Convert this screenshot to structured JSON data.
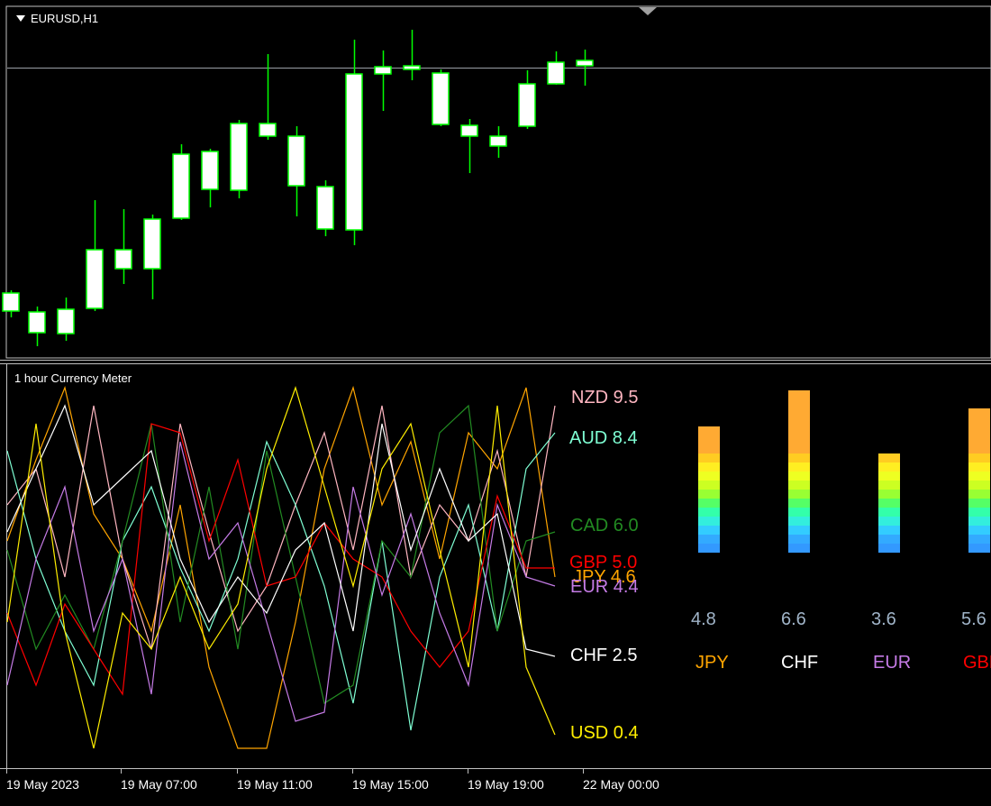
{
  "chart_window": {
    "symbol_title": "EURUSD,H1",
    "indicator_title": "1 hour Currency Meter",
    "time_labels": [
      "19 May 2023",
      "19 May 07:00",
      "19 May 11:00",
      "19 May 15:00",
      "19 May 19:00",
      "22 May 00:00"
    ]
  },
  "colors": {
    "background": "#000000",
    "bull_candle_border": "#00ff00",
    "candle_body": "#ffffff",
    "wick": "#00ff00",
    "price_line": "#9aa0a6",
    "separator": "#c0c0c0"
  },
  "currencies": {
    "NZD": {
      "label": "NZD 9.5",
      "color": "#ffb6c1"
    },
    "AUD": {
      "label": "AUD 8.4",
      "color": "#7fffd4"
    },
    "CAD": {
      "label": "CAD 6.0",
      "color": "#228b22"
    },
    "GBP": {
      "label": "GBP 5.0",
      "color": "#ff0000"
    },
    "JPY": {
      "label": "JPY 4.6",
      "color": "#ffa500"
    },
    "EUR": {
      "label": "EUR 4.4",
      "color": "#c57be6"
    },
    "CHF": {
      "label": "CHF 2.5",
      "color": "#ffffff"
    },
    "USD": {
      "label": "USD 0.4",
      "color": "#ffee00"
    }
  },
  "meter_bars": [
    {
      "value": "4.8",
      "name": "JPY",
      "name_color": "#ffa500",
      "level": 0.72
    },
    {
      "value": "6.6",
      "name": "CHF",
      "name_color": "#ffffff",
      "level": 0.98
    },
    {
      "value": "3.6",
      "name": "EUR",
      "name_color": "#c57be6",
      "level": 0.56
    },
    {
      "value": "5.6",
      "name": "GBP",
      "name_color": "#ff0000",
      "level": 0.84
    }
  ]
}
